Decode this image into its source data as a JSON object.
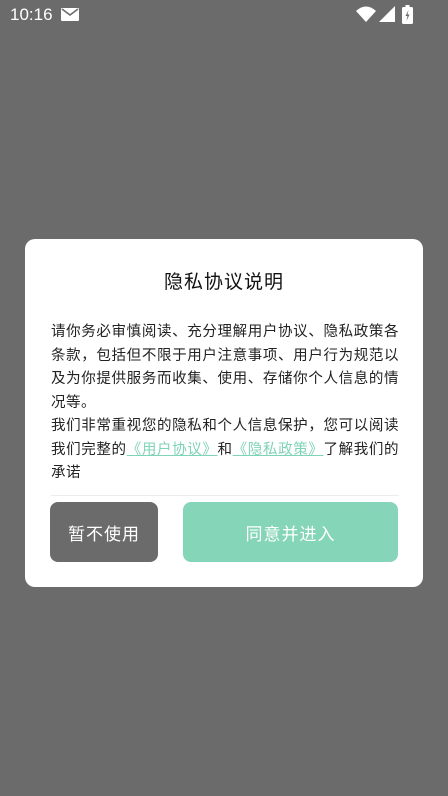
{
  "status_bar": {
    "time": "10:16",
    "icons": [
      "mail-icon",
      "wifi-icon",
      "signal-icon",
      "battery-icon"
    ]
  },
  "dialog": {
    "title": "隐私协议说明",
    "paragraph1": "请你务必审慎阅读、充分理解用户协议、隐私政策各条款，包括但不限于用户注意事项、用户行为规范以及为你提供服务而收集、使用、存储你个人信息的情况等。",
    "paragraph2_prefix": "我们非常重视您的隐私和个人信息保护，您可以阅读我们完整的",
    "link_user_agreement": "《用户协议》",
    "and_text": "和",
    "link_privacy_policy": "《隐私政策》",
    "paragraph2_suffix": "了解我们的承诺",
    "decline_label": "暂不使用",
    "agree_label": "同意并进入"
  },
  "colors": {
    "overlay": "#6b6b6b",
    "accent": "#7fd3b6",
    "decline_button": "#6b6b6b"
  }
}
